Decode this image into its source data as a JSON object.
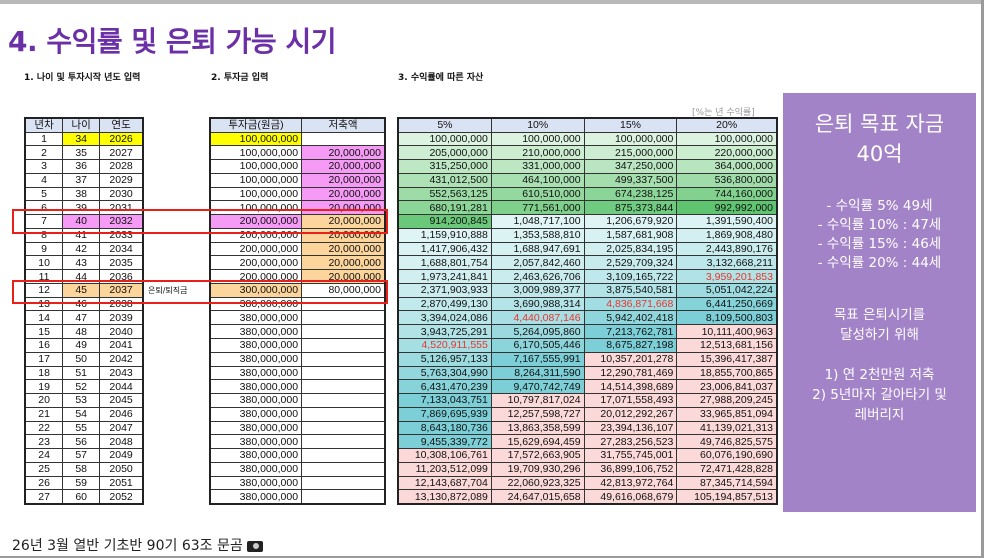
{
  "title": "4. 수익률 및 은퇴 가능 시기",
  "sections": {
    "s1": "1. 나이 및 투자시작 년도 입력",
    "s2": "2. 투자금 입력",
    "s3": "3. 수익률에 따른 자산"
  },
  "rate_note": "[%는 년 수익률]",
  "age_table": {
    "headers": [
      "년차",
      "나이",
      "연도"
    ],
    "rows": [
      [
        "1",
        "34",
        "2026"
      ],
      [
        "2",
        "35",
        "2027"
      ],
      [
        "3",
        "36",
        "2028"
      ],
      [
        "4",
        "37",
        "2029"
      ],
      [
        "5",
        "38",
        "2030"
      ],
      [
        "6",
        "39",
        "2031"
      ],
      [
        "7",
        "40",
        "2032"
      ],
      [
        "8",
        "41",
        "2033"
      ],
      [
        "9",
        "42",
        "2034"
      ],
      [
        "10",
        "43",
        "2035"
      ],
      [
        "11",
        "44",
        "2036"
      ],
      [
        "12",
        "45",
        "2037"
      ],
      [
        "13",
        "46",
        "2038"
      ],
      [
        "14",
        "47",
        "2039"
      ],
      [
        "15",
        "48",
        "2040"
      ],
      [
        "16",
        "49",
        "2041"
      ],
      [
        "17",
        "50",
        "2042"
      ],
      [
        "18",
        "51",
        "2043"
      ],
      [
        "19",
        "52",
        "2044"
      ],
      [
        "20",
        "53",
        "2045"
      ],
      [
        "21",
        "54",
        "2046"
      ],
      [
        "22",
        "55",
        "2047"
      ],
      [
        "23",
        "56",
        "2048"
      ],
      [
        "24",
        "57",
        "2049"
      ],
      [
        "25",
        "58",
        "2050"
      ],
      [
        "26",
        "59",
        "2051"
      ],
      [
        "27",
        "60",
        "2052"
      ]
    ]
  },
  "retire_label": "은퇴/퇴직금",
  "invest_table": {
    "headers": [
      "투자금(원금)",
      "저축액"
    ],
    "rows": [
      [
        "100,000,000",
        ""
      ],
      [
        "100,000,000",
        "20,000,000"
      ],
      [
        "100,000,000",
        "20,000,000"
      ],
      [
        "100,000,000",
        "20,000,000"
      ],
      [
        "100,000,000",
        "20,000,000"
      ],
      [
        "100,000,000",
        "20,000,000"
      ],
      [
        "200,000,000",
        "20,000,000"
      ],
      [
        "200,000,000",
        "20,000,000"
      ],
      [
        "200,000,000",
        "20,000,000"
      ],
      [
        "200,000,000",
        "20,000,000"
      ],
      [
        "200,000,000",
        "20,000,000"
      ],
      [
        "300,000,000",
        "80,000,000"
      ],
      [
        "380,000,000",
        ""
      ],
      [
        "380,000,000",
        ""
      ],
      [
        "380,000,000",
        ""
      ],
      [
        "380,000,000",
        ""
      ],
      [
        "380,000,000",
        ""
      ],
      [
        "380,000,000",
        ""
      ],
      [
        "380,000,000",
        ""
      ],
      [
        "380,000,000",
        ""
      ],
      [
        "380,000,000",
        ""
      ],
      [
        "380,000,000",
        ""
      ],
      [
        "380,000,000",
        ""
      ],
      [
        "380,000,000",
        ""
      ],
      [
        "380,000,000",
        ""
      ],
      [
        "380,000,000",
        ""
      ],
      [
        "380,000,000",
        ""
      ]
    ]
  },
  "returns_table": {
    "headers": [
      "5%",
      "10%",
      "15%",
      "20%"
    ],
    "rows": [
      [
        "100,000,000",
        "100,000,000",
        "100,000,000",
        "100,000,000"
      ],
      [
        "205,000,000",
        "210,000,000",
        "215,000,000",
        "220,000,000"
      ],
      [
        "315,250,000",
        "331,000,000",
        "347,250,000",
        "364,000,000"
      ],
      [
        "431,012,500",
        "464,100,000",
        "499,337,500",
        "536,800,000"
      ],
      [
        "552,563,125",
        "610,510,000",
        "674,238,125",
        "744,160,000"
      ],
      [
        "680,191,281",
        "771,561,000",
        "875,373,844",
        "992,992,000"
      ],
      [
        "914,200,845",
        "1,048,717,100",
        "1,206,679,920",
        "1,391,590,400"
      ],
      [
        "1,159,910,888",
        "1,353,588,810",
        "1,587,681,908",
        "1,869,908,480"
      ],
      [
        "1,417,906,432",
        "1,688,947,691",
        "2,025,834,195",
        "2,443,890,176"
      ],
      [
        "1,688,801,754",
        "2,057,842,460",
        "2,529,709,324",
        "3,132,668,211"
      ],
      [
        "1,973,241,841",
        "2,463,626,706",
        "3,109,165,722",
        "3,959,201,853"
      ],
      [
        "2,371,903,933",
        "3,009,989,377",
        "3,875,540,581",
        "5,051,042,224"
      ],
      [
        "2,870,499,130",
        "3,690,988,314",
        "4,836,871,668",
        "6,441,250,669"
      ],
      [
        "3,394,024,086",
        "4,440,087,146",
        "5,942,402,418",
        "8,109,500,803"
      ],
      [
        "3,943,725,291",
        "5,264,095,860",
        "7,213,762,781",
        "10,111,400,963"
      ],
      [
        "4,520,911,555",
        "6,170,505,446",
        "8,675,827,198",
        "12,513,681,156"
      ],
      [
        "5,126,957,133",
        "7,167,555,991",
        "10,357,201,278",
        "15,396,417,387"
      ],
      [
        "5,763,304,990",
        "8,264,311,590",
        "12,290,781,469",
        "18,855,700,865"
      ],
      [
        "6,431,470,239",
        "9,470,742,749",
        "14,514,398,689",
        "23,006,841,037"
      ],
      [
        "7,133,043,751",
        "10,797,817,024",
        "17,071,558,493",
        "27,988,209,245"
      ],
      [
        "7,869,695,939",
        "12,257,598,727",
        "20,012,292,267",
        "33,965,851,094"
      ],
      [
        "8,643,180,736",
        "13,863,358,599",
        "23,394,136,107",
        "41,139,021,313"
      ],
      [
        "9,455,339,772",
        "15,629,694,459",
        "27,283,256,523",
        "49,746,825,575"
      ],
      [
        "10,308,106,761",
        "17,572,663,905",
        "31,755,745,001",
        "60,076,190,690"
      ],
      [
        "11,203,512,099",
        "19,709,930,296",
        "36,899,106,752",
        "72,471,428,828"
      ],
      [
        "12,143,687,704",
        "22,060,923,325",
        "42,813,972,764",
        "87,345,714,594"
      ],
      [
        "13,130,872,089",
        "24,647,015,658",
        "49,616,068,679",
        "105,194,857,513"
      ]
    ],
    "target_reached": [
      [
        15,
        0
      ],
      [
        13,
        1
      ],
      [
        12,
        2
      ],
      [
        10,
        3
      ]
    ]
  },
  "panel": {
    "title": "은퇴 목표 자금",
    "amount": "40억",
    "list": [
      "- 수익률 5% 49세",
      "- 수익률 10% : 47세",
      "- 수익률 15% : 46세",
      "- 수익률 20% : 44세"
    ],
    "sub1": "목표 은퇴시기를",
    "sub2": "달성하기 위해",
    "plan1": "1) 연 2천만원 저축",
    "plan2": "2) 5년마자 갈아타기 및",
    "plan3": "레버리지"
  },
  "footer": "26년 3월 열반 기초반 90기 63조 문곰",
  "colors": {
    "title": "#6b2fa6",
    "panel": "#a383c8",
    "yellow": "#ffff00",
    "pink": "#f59af5",
    "orange": "#fcd59c",
    "red": "#e8201a"
  }
}
